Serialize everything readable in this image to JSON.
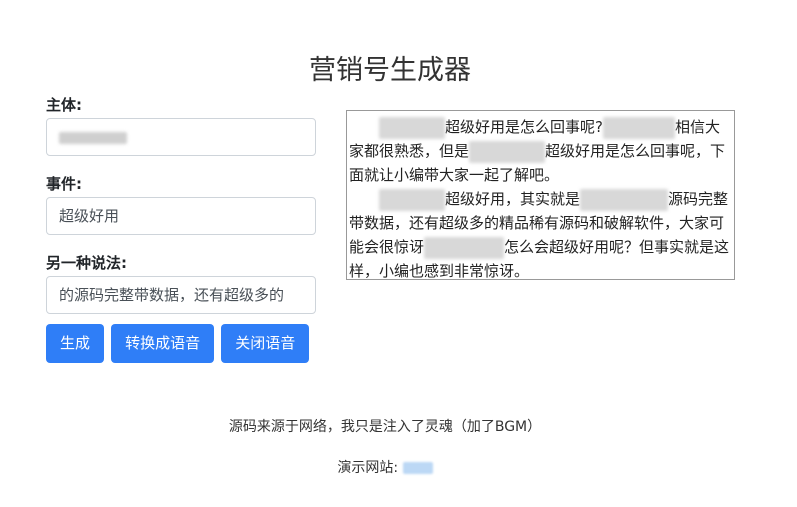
{
  "title": "营销号生成器",
  "form": {
    "subject_label": "主体:",
    "subject_value": "",
    "event_label": "事件:",
    "event_value": "超级好用",
    "alt_label": "另一种说法:",
    "alt_value": "的源码完整带数据，还有超级多的"
  },
  "buttons": {
    "generate": "生成",
    "to_speech": "转换成语音",
    "close_speech": "关闭语音"
  },
  "output": {
    "line1a": "超级好用是怎么回事呢?",
    "line1b": "相信大家都很熟悉，但是",
    "line1c": "超级好用是怎么回事呢，下面就让小编带大家一起了解吧。",
    "line2a": "超级好用，其实就是",
    "line2b": "源码完整带数据，还有超级多的精品稀有源码和破解软件，大家可能会很惊讶",
    "line2c": "怎么会超级好用呢？但事实就是这样，小编也感到非常惊讶。"
  },
  "footer": {
    "credit": "源码来源于网络，我只是注入了灵魂（加了BGM）",
    "demo_label": "演示网站:"
  },
  "colors": {
    "primary_button": "#2f7ef7",
    "border": "#ced4da"
  }
}
